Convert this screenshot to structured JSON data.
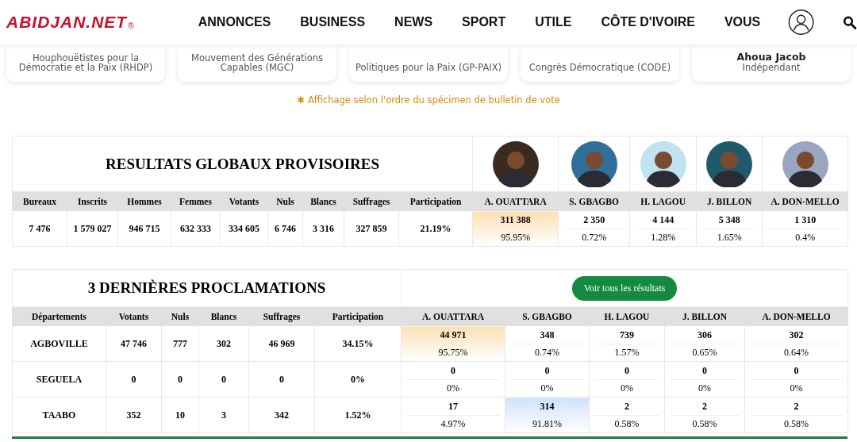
{
  "header": {
    "logo": "ABIDJAN.NET",
    "logo_mark": "®",
    "nav": [
      "ANNONCES",
      "BUSINESS",
      "NEWS",
      "SPORT",
      "UTILE",
      "CÔTE D'IVOIRE",
      "VOUS"
    ]
  },
  "cards": [
    {
      "party": "Houphouëtistes pour la Démocratie et la Paix (RHDP)"
    },
    {
      "party": "Mouvement des Générations Capables (MGC)"
    },
    {
      "party": "Politiques pour la Paix (GP-PAIX)"
    },
    {
      "party": "Congrès Démocratique (CODE)"
    },
    {
      "name": "Ahoua Jacob",
      "party": "Indépendant"
    }
  ],
  "note": {
    "mark": "✱",
    "text": "Affichage selon l'ordre du spécimen de bulletin de vote"
  },
  "global": {
    "title": "RESULTATS GLOBAUX PROVISOIRES",
    "candidates": [
      "A. OUATTARA",
      "S. GBAGBO",
      "H. LAGOU",
      "J. BILLON",
      "A. DON-MELLO"
    ],
    "columns": [
      "Bureaux",
      "Inscrits",
      "Hommes",
      "Femmes",
      "Votants",
      "Nuls",
      "Blancs",
      "Suffrages",
      "Participation"
    ],
    "values": [
      "7 476",
      "1 579 027",
      "946 715",
      "632 333",
      "334 605",
      "6 746",
      "3 316",
      "327 859",
      "21.19%"
    ],
    "results": [
      {
        "votes": "311 388",
        "pct": "95.95%",
        "highlighted": true
      },
      {
        "votes": "2 350",
        "pct": "0.72%",
        "highlighted": false
      },
      {
        "votes": "4 144",
        "pct": "1.28%",
        "highlighted": false
      },
      {
        "votes": "5 348",
        "pct": "1.65%",
        "highlighted": false
      },
      {
        "votes": "1 310",
        "pct": "0.4%",
        "highlighted": false
      }
    ]
  },
  "proclamations": {
    "title": "3 DERNIÈRES PROCLAMATIONS",
    "button": "Voir tous les résultats",
    "columns": [
      "Départements",
      "Votants",
      "Nuls",
      "Blancs",
      "Suffrages",
      "Participation"
    ],
    "candidates": [
      "A. OUATTARA",
      "S. GBAGBO",
      "H. LAGOU",
      "J. BILLON",
      "A. DON-MELLO"
    ],
    "rows": [
      {
        "cells": [
          "AGBOVILLE",
          "47 746",
          "777",
          "302",
          "46 969",
          "34.15%"
        ],
        "results": [
          {
            "votes": "44 971",
            "pct": "95.75%",
            "highlighted": true
          },
          {
            "votes": "348",
            "pct": "0.74%",
            "highlighted": false
          },
          {
            "votes": "739",
            "pct": "1.57%",
            "highlighted": false
          },
          {
            "votes": "306",
            "pct": "0.65%",
            "highlighted": false
          },
          {
            "votes": "302",
            "pct": "0.64%",
            "highlighted": false
          }
        ]
      },
      {
        "cells": [
          "SEGUELA",
          "0",
          "0",
          "0",
          "0",
          "0%"
        ],
        "results": [
          {
            "votes": "0",
            "pct": "0%",
            "highlighted": false
          },
          {
            "votes": "0",
            "pct": "0%",
            "highlighted": false
          },
          {
            "votes": "0",
            "pct": "0%",
            "highlighted": false
          },
          {
            "votes": "0",
            "pct": "0%",
            "highlighted": false
          },
          {
            "votes": "0",
            "pct": "0%",
            "highlighted": false
          }
        ]
      },
      {
        "cells": [
          "TAABO",
          "352",
          "10",
          "3",
          "342",
          "1.52%"
        ],
        "results": [
          {
            "votes": "17",
            "pct": "4.97%",
            "highlighted": false
          },
          {
            "votes": "314",
            "pct": "91.81%",
            "highlighted": true
          },
          {
            "votes": "2",
            "pct": "0.58%",
            "highlighted": false
          },
          {
            "votes": "2",
            "pct": "0.58%",
            "highlighted": false
          },
          {
            "votes": "2",
            "pct": "0.58%",
            "highlighted": false
          }
        ]
      }
    ]
  }
}
